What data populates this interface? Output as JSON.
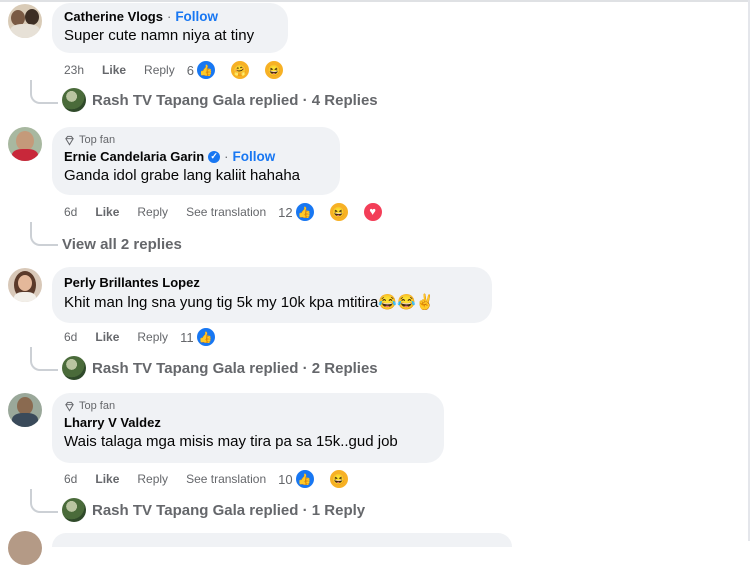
{
  "comments": [
    {
      "author": "Catherine Vlogs",
      "follow": "Follow",
      "top_fan": "",
      "text": "Super cute namn niya at tiny",
      "time": "23h",
      "like": "Like",
      "reply": "Reply",
      "see_translation": "",
      "reaction_count": "6",
      "reactions": [
        "like-icon",
        "care-icon",
        "haha-icon"
      ],
      "replies_link": "Rash TV Tapang Gala replied · 4 Replies"
    },
    {
      "author": "Ernie Candelaria Garin",
      "follow": "Follow",
      "top_fan": "Top fan",
      "verified": true,
      "text": "Ganda idol grabe lang kaliit hahaha",
      "time": "6d",
      "like": "Like",
      "reply": "Reply",
      "see_translation": "See translation",
      "reaction_count": "12",
      "reactions": [
        "like-icon",
        "haha-icon",
        "love-icon"
      ],
      "replies_link": "View all 2 replies"
    },
    {
      "author": "Perly Brillantes Lopez",
      "follow": "",
      "top_fan": "",
      "text": "Khit man lng sna yung tig 5k my 10k kpa mtitira😂😂✌",
      "time": "6d",
      "like": "Like",
      "reply": "Reply",
      "see_translation": "",
      "reaction_count": "11",
      "reactions": [
        "like-icon"
      ],
      "replies_link": "Rash TV Tapang Gala replied · 2 Replies"
    },
    {
      "author": "Lharry V Valdez",
      "follow": "",
      "top_fan": "Top fan",
      "text": "Wais talaga mga misis may tira pa sa 15k..gud job",
      "time": "6d",
      "like": "Like",
      "reply": "Reply",
      "see_translation": "See translation",
      "reaction_count": "10",
      "reactions": [
        "like-icon",
        "haha-icon"
      ],
      "replies_link": "Rash TV Tapang Gala replied · 1 Reply"
    }
  ],
  "colors": {
    "accent": "#1877f2",
    "bubble": "#f0f2f5",
    "muted": "#65676b"
  }
}
